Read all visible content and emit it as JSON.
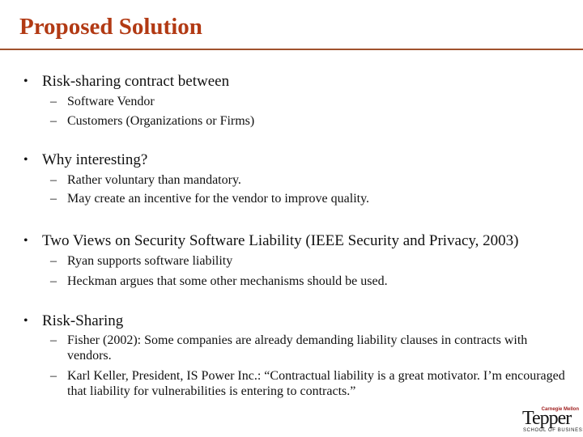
{
  "slide": {
    "title": "Proposed Solution",
    "colors": {
      "title": "#b23a14",
      "rule": "#a0522d",
      "body_text": "#111111",
      "logo_accent": "#a02020"
    },
    "bullet_glyph": "•",
    "sub_bullet_glyph": "–",
    "bullets": [
      {
        "text": "Risk-sharing contract between",
        "sub": [
          "Software Vendor",
          "Customers (Organizations or Firms)"
        ]
      },
      {
        "text": "Why interesting?",
        "sub": [
          "Rather voluntary than mandatory.",
          "May create an incentive for the vendor to improve quality."
        ]
      },
      {
        "text": "Two Views on Security Software Liability (IEEE Security and Privacy, 2003)",
        "sub": [
          "Ryan supports software liability",
          "Heckman argues that some other mechanisms should be used."
        ]
      },
      {
        "text": "Risk-Sharing",
        "sub": [
          "Fisher (2002): Some companies are already demanding liability clauses in contracts with vendors.",
          "Karl Keller, President, IS Power Inc.: “Contractual liability is a great motivator. I’m encouraged that liability for vulnerabilities is entering to contracts.”"
        ]
      }
    ],
    "logo": {
      "top_text": "Carnegie Mellon",
      "main_text": "Tepper",
      "bottom_text": "SCHOOL OF BUSINESS"
    }
  }
}
